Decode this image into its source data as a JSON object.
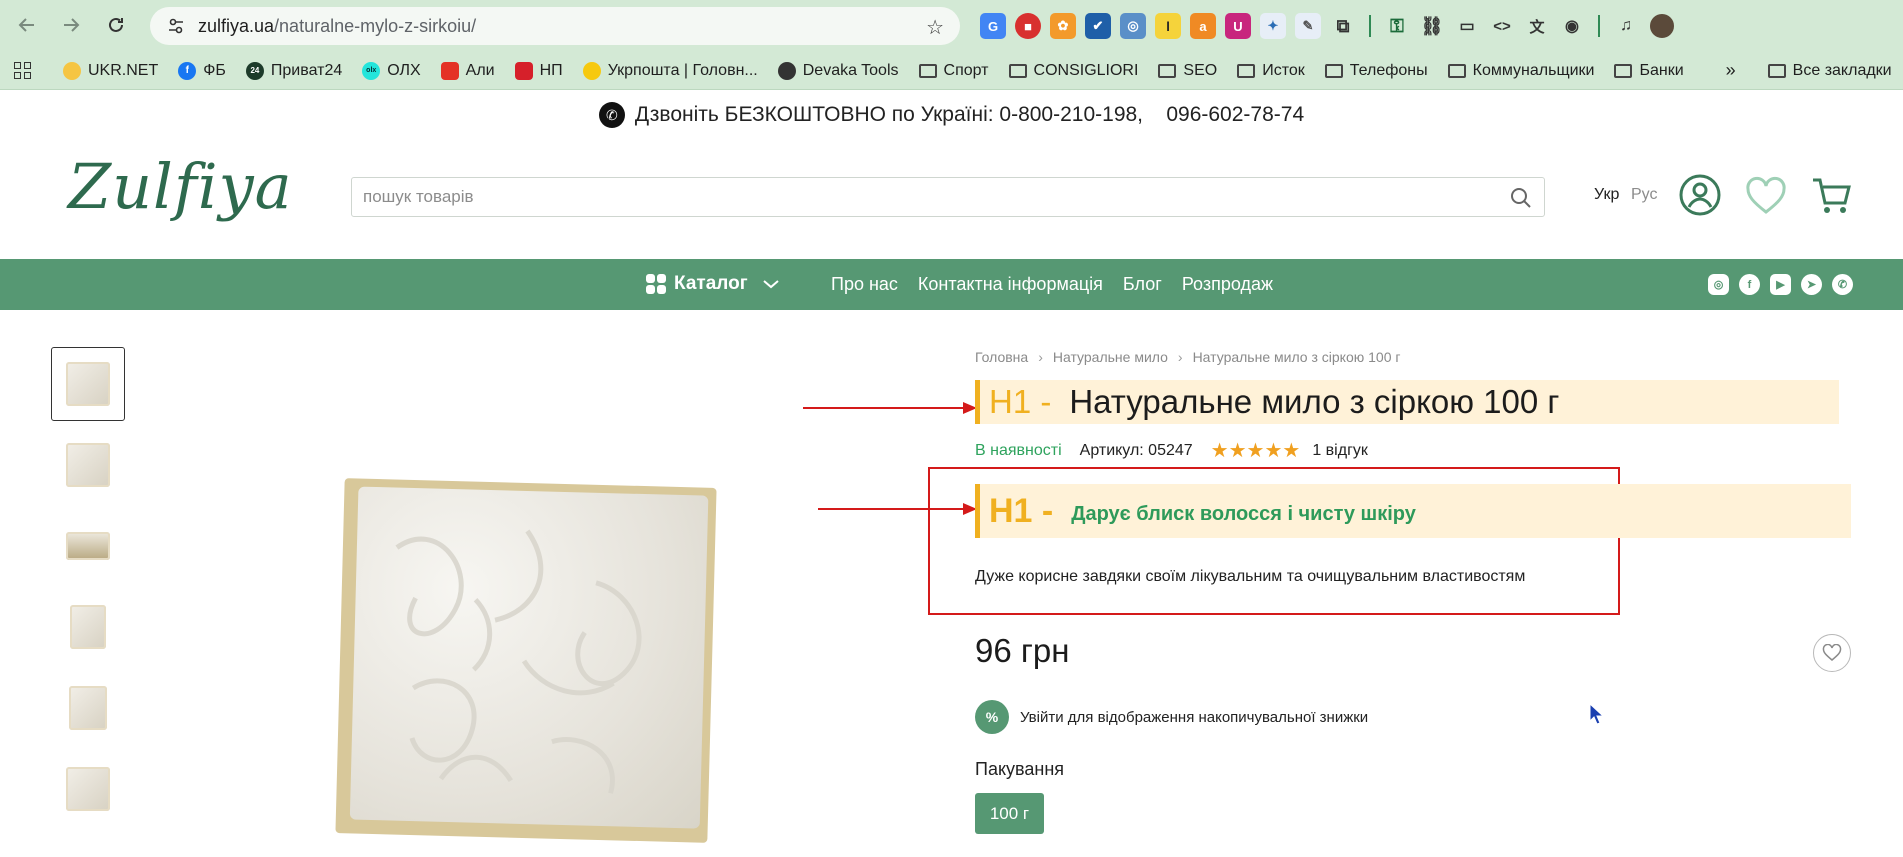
{
  "browser": {
    "url_domain": "zulfiya.ua",
    "url_path": "/naturalne-mylo-z-sirkoiu/",
    "bookmarks": [
      "UKR.NET",
      "ФБ",
      "Приват24",
      "ОЛХ",
      "Али",
      "НП",
      "Укрпошта | Головн...",
      "Devaka Tools",
      "Спорт",
      "CONSIGLIORI",
      "SEO",
      "Исток",
      "Телефоны",
      "Коммунальщики",
      "Банки"
    ],
    "bookmarks_more": "»",
    "all_bookmarks": "Все закладки",
    "ext_fb_label": "f",
    "ext_p24_label": "24",
    "ext_olx_label": "olx"
  },
  "site": {
    "phone_text": "Дзвоніть БЕЗКОШТОВНО по Україні: 0-800-210-198,    096-602-78-74",
    "logo": "Zulfiya",
    "search_placeholder": "пошук товарів",
    "lang_ukr": "Укр",
    "lang_rus": "Рус",
    "nav": {
      "catalog": "Каталог",
      "links": [
        "Про нас",
        "Контактна інформація",
        "Блог",
        "Розпродаж"
      ]
    }
  },
  "product": {
    "breadcrumb": [
      "Головна",
      "Натуральне мило",
      "Натуральне мило з сіркою 100 г"
    ],
    "h1_tag": "H1 -",
    "title": "Натуральне мило з сіркою 100 г",
    "stock": "В наявності",
    "sku": "Артикул: 05247",
    "stars": "★★★★★",
    "rating": 5,
    "reviews": "1 відгук",
    "h2_tag": "H1 -",
    "subtitle": "Дарує блиск волосся і чисту шкіру",
    "description": "Дуже корисне завдяки своїм лікувальним та очищувальним властивостям",
    "price": "96 грн",
    "discount_badge": "%",
    "discount_text": "Увійти для відображення накопичувальної знижки",
    "pack_label": "Пакування",
    "pack_option": "100 г"
  },
  "colors": {
    "brand_green": "#569873",
    "highlight_bg": "#fff2d8",
    "highlight_accent": "#f0b020",
    "annotation_red": "#d41a1a",
    "stock_green": "#2ea35d"
  }
}
